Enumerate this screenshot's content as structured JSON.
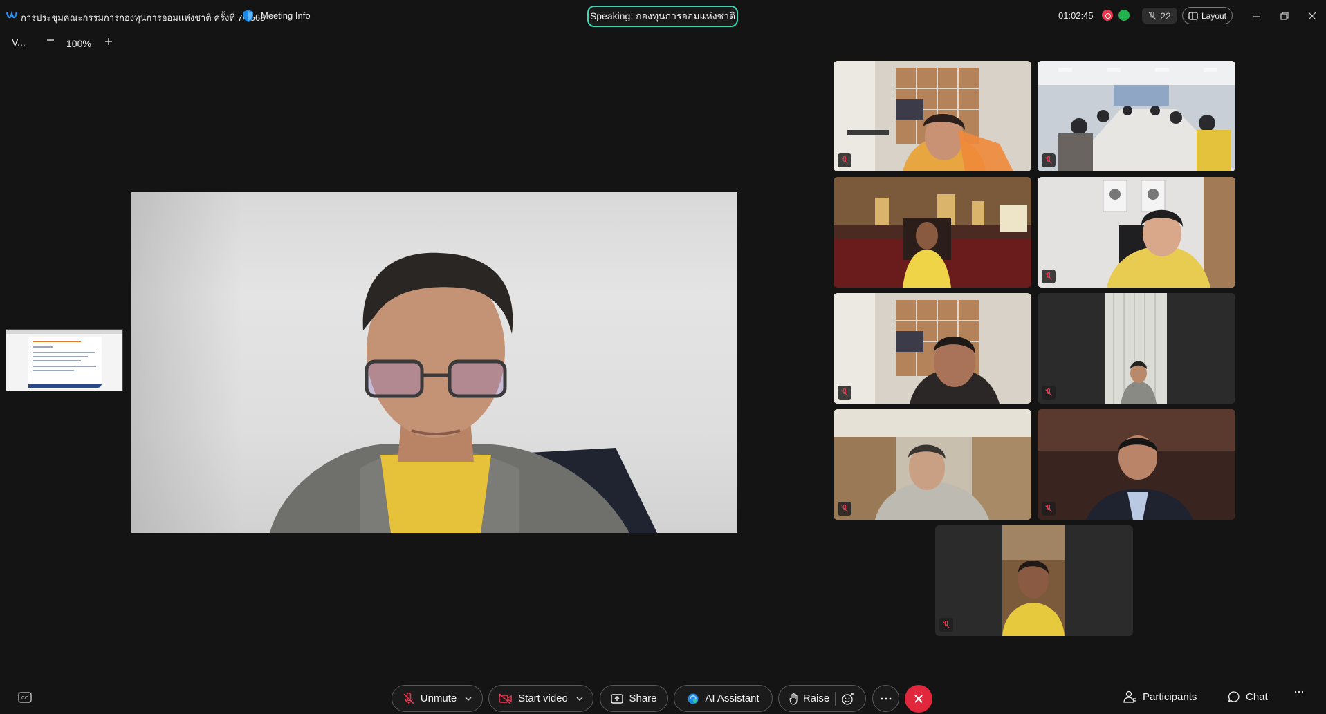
{
  "titlebar": {
    "meeting_title": "การประชุมคณะกรรมการกองทุนการออมแห่งชาติ ครั้งที่ 7/2568",
    "meeting_info": "Meeting Info",
    "speaking": "Speaking: กองทุนการออมแห่งชาติ",
    "timer": "01:02:45",
    "attendee_count": "22",
    "layout_label": "Layout"
  },
  "share_view": {
    "name": "V...",
    "zoom_level": "100%"
  },
  "gallery": {
    "tiles": [
      {
        "muted": true
      },
      {
        "muted": true
      },
      {
        "muted": false
      },
      {
        "muted": true
      },
      {
        "muted": true
      },
      {
        "muted": true
      },
      {
        "muted": true
      },
      {
        "muted": true
      },
      {
        "muted": true
      }
    ]
  },
  "toolbar": {
    "unmute": "Unmute",
    "start_video": "Start video",
    "share": "Share",
    "ai_assistant": "AI Assistant",
    "raise": "Raise",
    "participants": "Participants",
    "chat": "Chat"
  },
  "colors": {
    "background": "#141414",
    "speaking_border": "#3fd6b4",
    "end_call": "#e0273c",
    "mute_icon": "#e8384f"
  }
}
